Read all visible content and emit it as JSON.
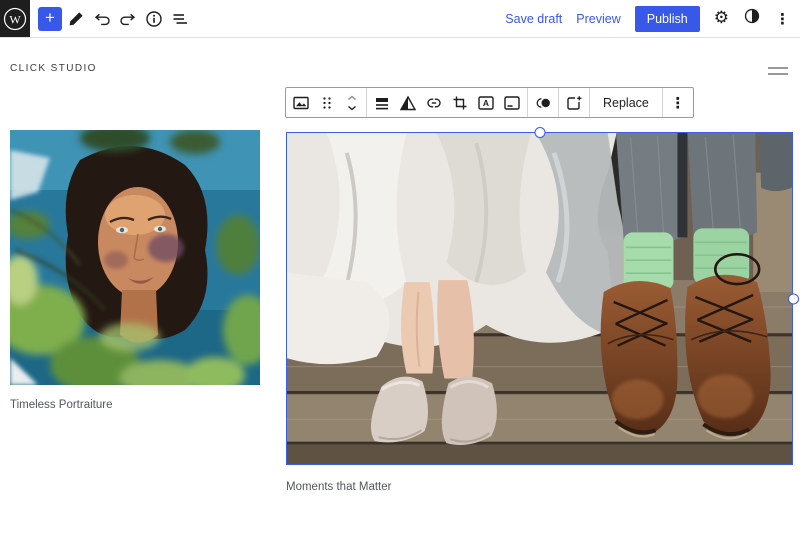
{
  "topbar": {
    "save_draft_label": "Save draft",
    "preview_label": "Preview",
    "publish_label": "Publish"
  },
  "icons": {
    "wp_logo_letter": "W",
    "add_glyph": "+",
    "settings_glyph": "⚙",
    "options_glyph": "⋮",
    "block_options_glyph": "⋮",
    "text_overlay_letter": "A",
    "topbar_names": [
      "wordpress-logo",
      "add-block",
      "tools-pencil",
      "undo",
      "redo",
      "info",
      "list-view",
      "settings-gear",
      "styles-contrast",
      "options-menu"
    ],
    "block_toolbar_names": [
      "image-block",
      "drag-handle",
      "move-up-down",
      "align",
      "duotone-filter",
      "link",
      "crop",
      "text-over-image",
      "caption",
      "duotone",
      "expand-on-click",
      "replace",
      "options"
    ]
  },
  "site_header": {
    "title": "CLICK STUDIO"
  },
  "block_toolbar": {
    "replace_label": "Replace"
  },
  "figures": [
    {
      "caption": "Timeless Portraiture",
      "selected": false
    },
    {
      "caption": "Moments that Matter",
      "selected": true
    }
  ],
  "colors": {
    "accent_blue": "#3858e9",
    "selection_border": "#3f5ee8",
    "toolbar_border": "#9b9b9b",
    "caption_text": "#50575e",
    "topbar_icon": "#1e1e1e"
  }
}
